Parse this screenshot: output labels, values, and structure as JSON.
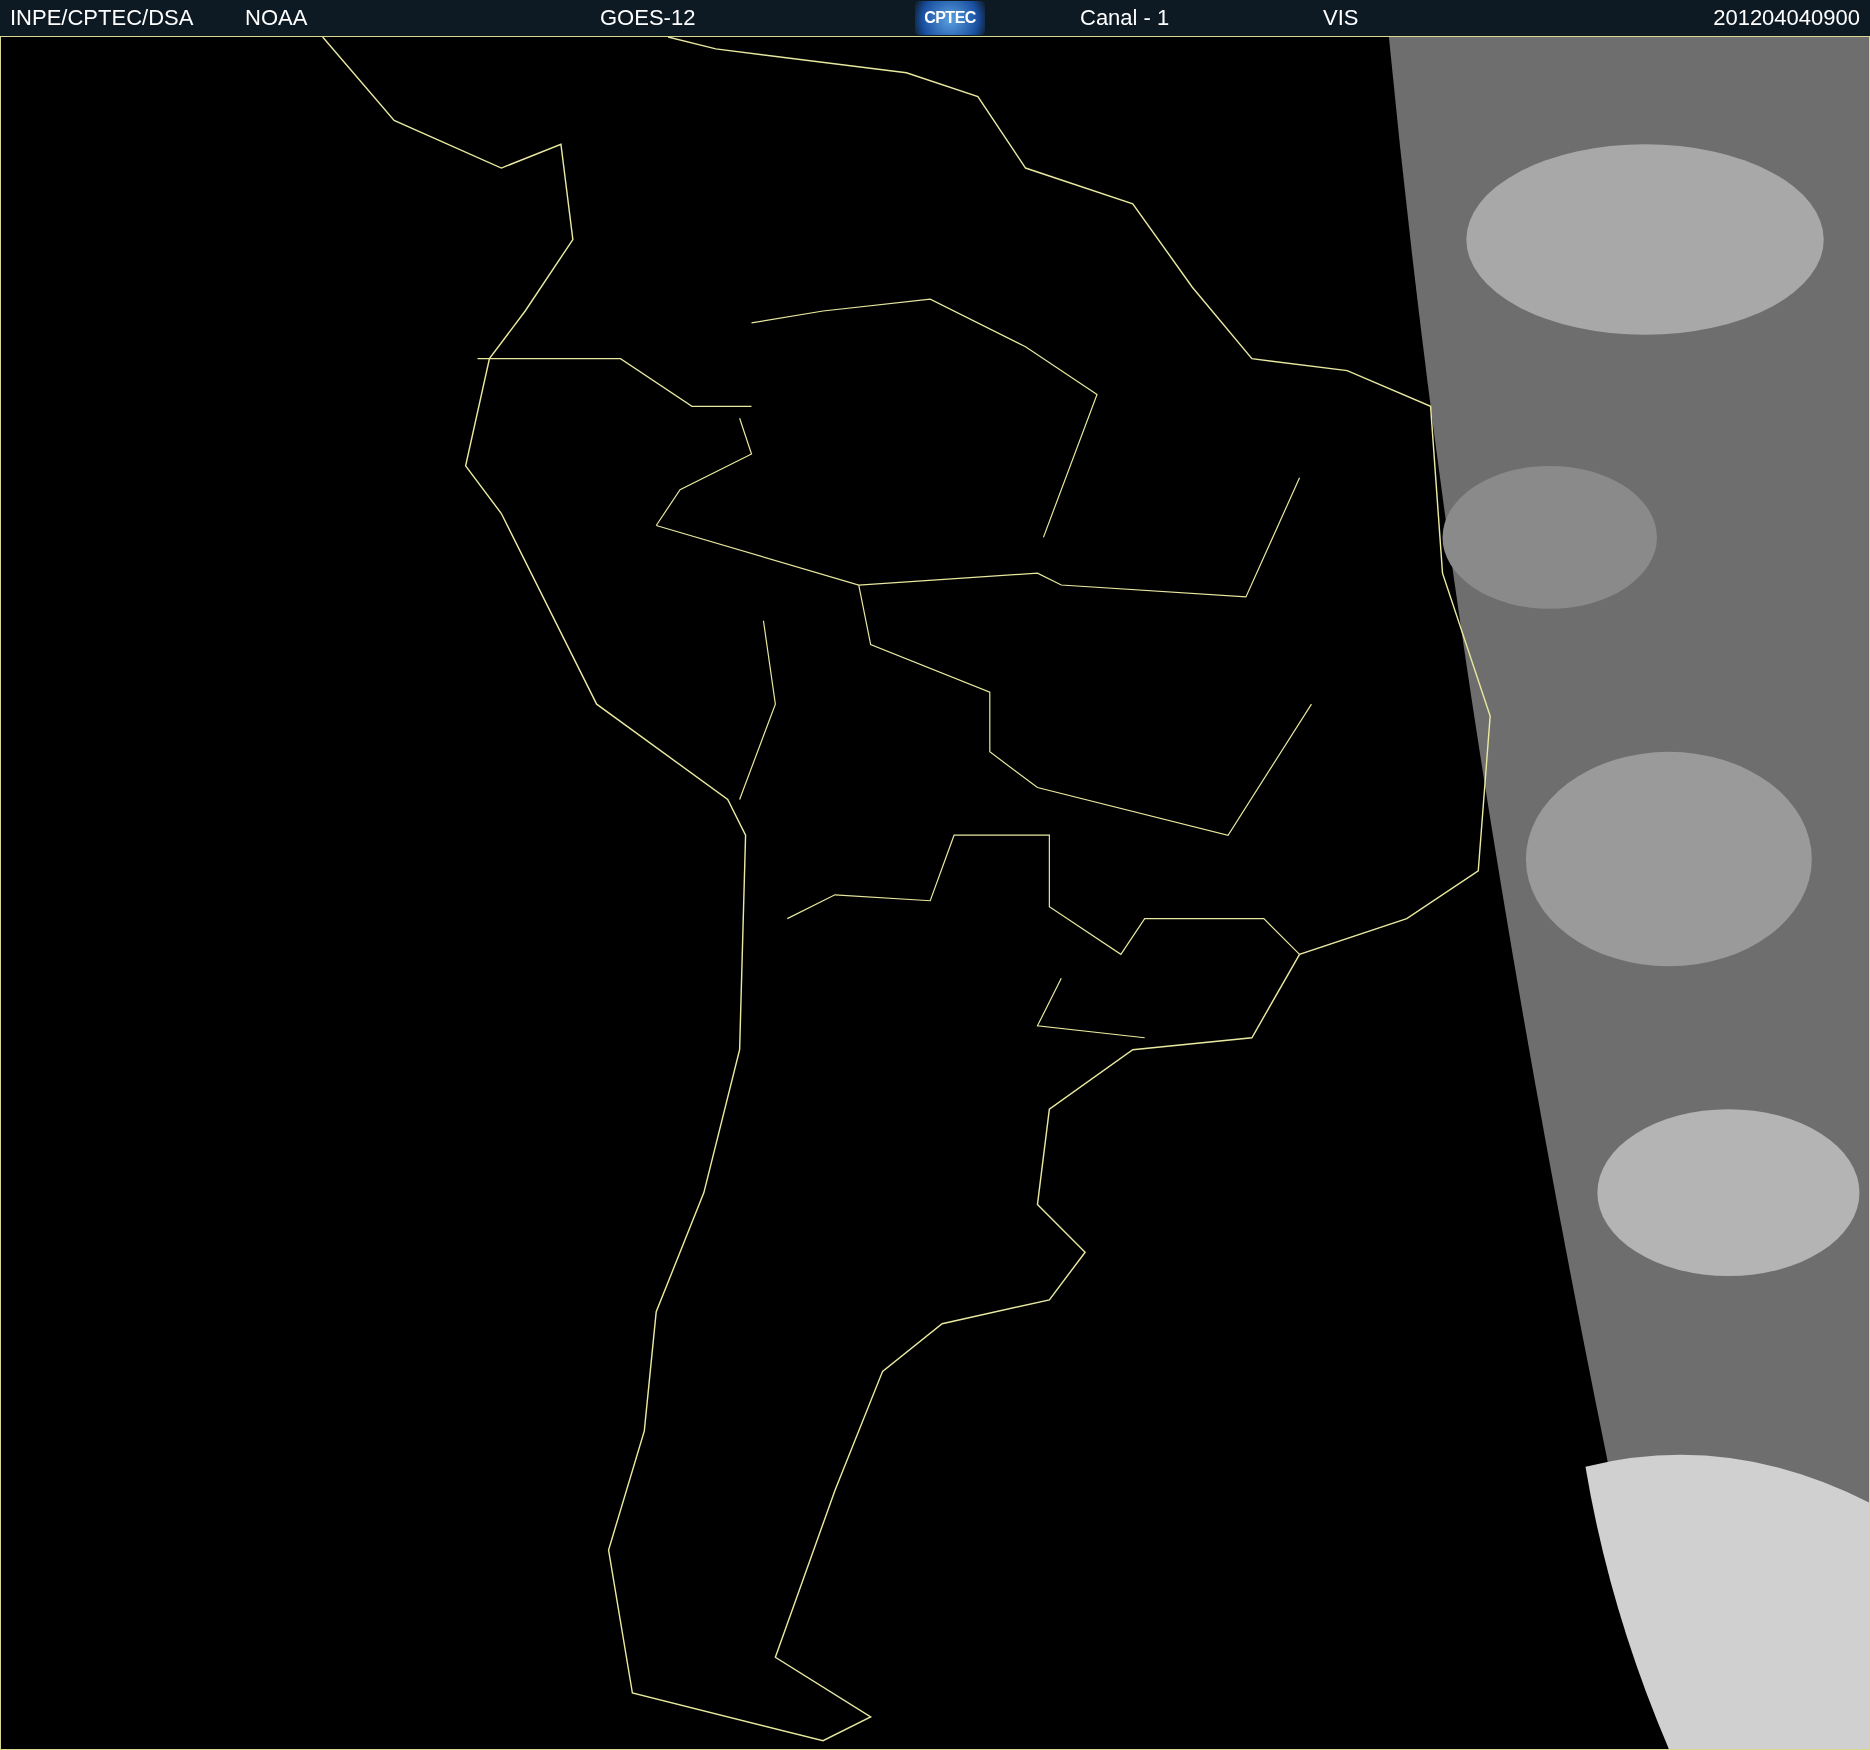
{
  "header": {
    "items": [
      {
        "kind": "text",
        "text": "INPE/CPTEC/DSA"
      },
      {
        "kind": "text",
        "text": "NOAA"
      },
      {
        "kind": "text",
        "text": "GOES-12"
      },
      {
        "kind": "logo",
        "text": "CPTEC"
      },
      {
        "kind": "text",
        "text": "Canal - 1"
      },
      {
        "kind": "text",
        "text": "VIS"
      },
      {
        "kind": "text",
        "text": "201204040900"
      }
    ]
  }
}
